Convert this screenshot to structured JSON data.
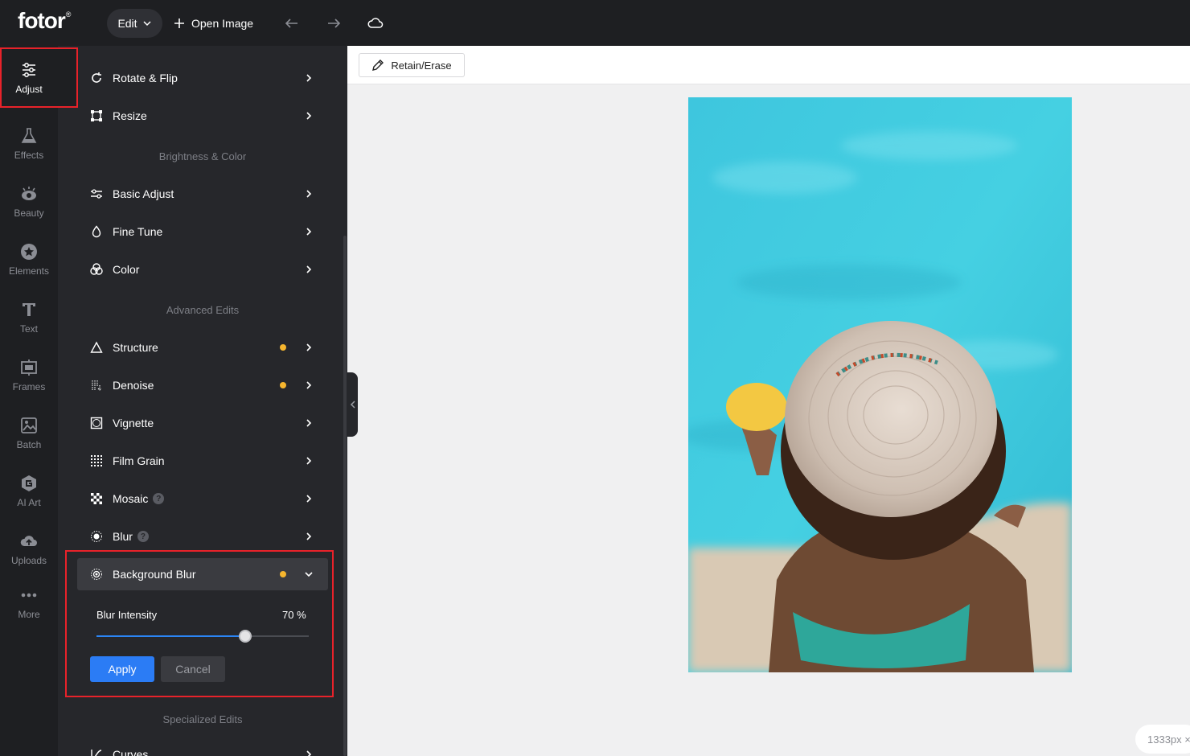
{
  "topbar": {
    "logo": "fotor",
    "logo_mark": "®",
    "edit_label": "Edit",
    "open_image_label": "Open Image"
  },
  "nav": {
    "items": [
      {
        "label": "Adjust",
        "icon": "sliders-icon"
      },
      {
        "label": "Effects",
        "icon": "flask-icon"
      },
      {
        "label": "Beauty",
        "icon": "eye-icon"
      },
      {
        "label": "Elements",
        "icon": "star-icon"
      },
      {
        "label": "Text",
        "icon": "text-icon"
      },
      {
        "label": "Frames",
        "icon": "frame-icon"
      },
      {
        "label": "Batch",
        "icon": "batch-icon"
      },
      {
        "label": "AI Art",
        "icon": "ai-art-icon"
      },
      {
        "label": "Uploads",
        "icon": "upload-cloud-icon"
      },
      {
        "label": "More",
        "icon": "more-dots-icon"
      }
    ]
  },
  "panel": {
    "rotate_flip": "Rotate & Flip",
    "resize": "Resize",
    "section_brightness": "Brightness & Color",
    "basic_adjust": "Basic Adjust",
    "fine_tune": "Fine Tune",
    "color": "Color",
    "section_advanced": "Advanced Edits",
    "structure": "Structure",
    "denoise": "Denoise",
    "vignette": "Vignette",
    "film_grain": "Film Grain",
    "mosaic": "Mosaic",
    "blur": "Blur",
    "background_blur": "Background Blur",
    "blur_intensity_label": "Blur Intensity",
    "blur_intensity_value": "70 %",
    "blur_intensity_fraction": 0.7,
    "apply": "Apply",
    "cancel": "Cancel",
    "section_specialized": "Specialized Edits",
    "curves": "Curves",
    "help_glyph": "?"
  },
  "toolbar": {
    "retain_erase": "Retain/Erase"
  },
  "canvas": {
    "size_badge": "1333px ×"
  },
  "colors": {
    "accent_blue": "#2b7cf5",
    "highlight_red": "#e8222a",
    "dot_yellow": "#f5b52e"
  }
}
